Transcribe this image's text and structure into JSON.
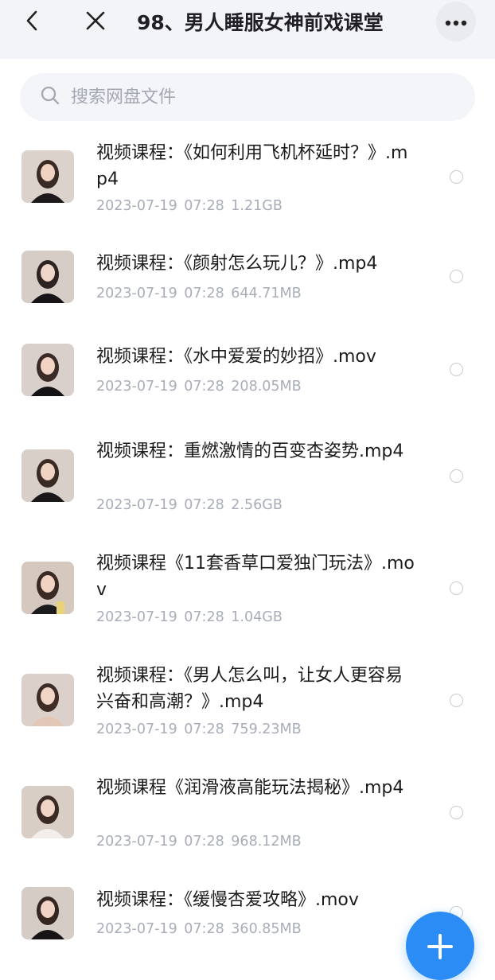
{
  "header": {
    "title": "98、男人睡服女神前戏课堂",
    "back_icon": "chevron-left-icon",
    "close_icon": "close-icon",
    "more_icon": "more-dots-icon"
  },
  "search": {
    "placeholder": "搜索网盘文件",
    "value": "",
    "icon": "search-icon"
  },
  "files": [
    {
      "name": "视频课程：《如何利用飞机杯延时？》.mp4",
      "date": "2023-07-19",
      "time": "07:28",
      "size": "1.21GB"
    },
    {
      "name": "视频课程：《颜射怎么玩儿？》.mp4",
      "date": "2023-07-19",
      "time": "07:28",
      "size": "644.71MB"
    },
    {
      "name": "视频课程：《水中爱爱的妙招》.mov",
      "date": "2023-07-19",
      "time": "07:28",
      "size": "208.05MB"
    },
    {
      "name": "视频课程：重燃激情的百变杏姿势.mp4",
      "date": "2023-07-19",
      "time": "07:28",
      "size": "2.56GB"
    },
    {
      "name": "视频课程《11套香草口爱独门玩法》.mov",
      "date": "2023-07-19",
      "time": "07:28",
      "size": "1.04GB"
    },
    {
      "name": "视频课程：《男人怎么叫，让女人更容易兴奋和高潮？》.mp4",
      "date": "2023-07-19",
      "time": "07:28",
      "size": "759.23MB"
    },
    {
      "name": "视频课程《润滑液高能玩法揭秘》.mp4",
      "date": "2023-07-19",
      "time": "07:28",
      "size": "968.12MB"
    },
    {
      "name": "视频课程：《缓慢杏爱攻略》.mov",
      "date": "2023-07-19",
      "time": "07:28",
      "size": "360.85MB"
    }
  ],
  "fab": {
    "icon": "plus-icon"
  },
  "colors": {
    "accent": "#2b8cf5",
    "meta_text": "#a8adb7",
    "header_bg": "#f3f4f7"
  }
}
